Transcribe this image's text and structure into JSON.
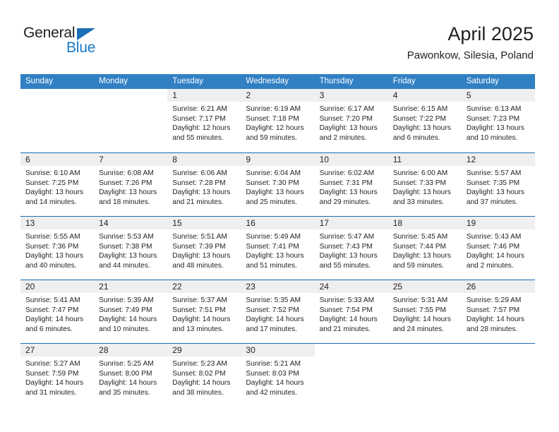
{
  "branding": {
    "logo_primary": "General",
    "logo_secondary": "Blue"
  },
  "header": {
    "title": "April 2025",
    "subtitle": "Pawonkow, Silesia, Poland"
  },
  "colors": {
    "header_blue": "#3180c4",
    "row_divider_blue": "#1f6cb0",
    "daynum_band": "#efefef",
    "logo_blue": "#1878c4",
    "text": "#231f20"
  },
  "weekdays": [
    "Sunday",
    "Monday",
    "Tuesday",
    "Wednesday",
    "Thursday",
    "Friday",
    "Saturday"
  ],
  "weeks": [
    [
      {
        "day": "",
        "sunrise": "",
        "sunset": "",
        "daylight_1": "",
        "daylight_2": ""
      },
      {
        "day": "",
        "sunrise": "",
        "sunset": "",
        "daylight_1": "",
        "daylight_2": ""
      },
      {
        "day": "1",
        "sunrise": "Sunrise: 6:21 AM",
        "sunset": "Sunset: 7:17 PM",
        "daylight_1": "Daylight: 12 hours",
        "daylight_2": "and 55 minutes."
      },
      {
        "day": "2",
        "sunrise": "Sunrise: 6:19 AM",
        "sunset": "Sunset: 7:18 PM",
        "daylight_1": "Daylight: 12 hours",
        "daylight_2": "and 59 minutes."
      },
      {
        "day": "3",
        "sunrise": "Sunrise: 6:17 AM",
        "sunset": "Sunset: 7:20 PM",
        "daylight_1": "Daylight: 13 hours",
        "daylight_2": "and 2 minutes."
      },
      {
        "day": "4",
        "sunrise": "Sunrise: 6:15 AM",
        "sunset": "Sunset: 7:22 PM",
        "daylight_1": "Daylight: 13 hours",
        "daylight_2": "and 6 minutes."
      },
      {
        "day": "5",
        "sunrise": "Sunrise: 6:13 AM",
        "sunset": "Sunset: 7:23 PM",
        "daylight_1": "Daylight: 13 hours",
        "daylight_2": "and 10 minutes."
      }
    ],
    [
      {
        "day": "6",
        "sunrise": "Sunrise: 6:10 AM",
        "sunset": "Sunset: 7:25 PM",
        "daylight_1": "Daylight: 13 hours",
        "daylight_2": "and 14 minutes."
      },
      {
        "day": "7",
        "sunrise": "Sunrise: 6:08 AM",
        "sunset": "Sunset: 7:26 PM",
        "daylight_1": "Daylight: 13 hours",
        "daylight_2": "and 18 minutes."
      },
      {
        "day": "8",
        "sunrise": "Sunrise: 6:06 AM",
        "sunset": "Sunset: 7:28 PM",
        "daylight_1": "Daylight: 13 hours",
        "daylight_2": "and 21 minutes."
      },
      {
        "day": "9",
        "sunrise": "Sunrise: 6:04 AM",
        "sunset": "Sunset: 7:30 PM",
        "daylight_1": "Daylight: 13 hours",
        "daylight_2": "and 25 minutes."
      },
      {
        "day": "10",
        "sunrise": "Sunrise: 6:02 AM",
        "sunset": "Sunset: 7:31 PM",
        "daylight_1": "Daylight: 13 hours",
        "daylight_2": "and 29 minutes."
      },
      {
        "day": "11",
        "sunrise": "Sunrise: 6:00 AM",
        "sunset": "Sunset: 7:33 PM",
        "daylight_1": "Daylight: 13 hours",
        "daylight_2": "and 33 minutes."
      },
      {
        "day": "12",
        "sunrise": "Sunrise: 5:57 AM",
        "sunset": "Sunset: 7:35 PM",
        "daylight_1": "Daylight: 13 hours",
        "daylight_2": "and 37 minutes."
      }
    ],
    [
      {
        "day": "13",
        "sunrise": "Sunrise: 5:55 AM",
        "sunset": "Sunset: 7:36 PM",
        "daylight_1": "Daylight: 13 hours",
        "daylight_2": "and 40 minutes."
      },
      {
        "day": "14",
        "sunrise": "Sunrise: 5:53 AM",
        "sunset": "Sunset: 7:38 PM",
        "daylight_1": "Daylight: 13 hours",
        "daylight_2": "and 44 minutes."
      },
      {
        "day": "15",
        "sunrise": "Sunrise: 5:51 AM",
        "sunset": "Sunset: 7:39 PM",
        "daylight_1": "Daylight: 13 hours",
        "daylight_2": "and 48 minutes."
      },
      {
        "day": "16",
        "sunrise": "Sunrise: 5:49 AM",
        "sunset": "Sunset: 7:41 PM",
        "daylight_1": "Daylight: 13 hours",
        "daylight_2": "and 51 minutes."
      },
      {
        "day": "17",
        "sunrise": "Sunrise: 5:47 AM",
        "sunset": "Sunset: 7:43 PM",
        "daylight_1": "Daylight: 13 hours",
        "daylight_2": "and 55 minutes."
      },
      {
        "day": "18",
        "sunrise": "Sunrise: 5:45 AM",
        "sunset": "Sunset: 7:44 PM",
        "daylight_1": "Daylight: 13 hours",
        "daylight_2": "and 59 minutes."
      },
      {
        "day": "19",
        "sunrise": "Sunrise: 5:43 AM",
        "sunset": "Sunset: 7:46 PM",
        "daylight_1": "Daylight: 14 hours",
        "daylight_2": "and 2 minutes."
      }
    ],
    [
      {
        "day": "20",
        "sunrise": "Sunrise: 5:41 AM",
        "sunset": "Sunset: 7:47 PM",
        "daylight_1": "Daylight: 14 hours",
        "daylight_2": "and 6 minutes."
      },
      {
        "day": "21",
        "sunrise": "Sunrise: 5:39 AM",
        "sunset": "Sunset: 7:49 PM",
        "daylight_1": "Daylight: 14 hours",
        "daylight_2": "and 10 minutes."
      },
      {
        "day": "22",
        "sunrise": "Sunrise: 5:37 AM",
        "sunset": "Sunset: 7:51 PM",
        "daylight_1": "Daylight: 14 hours",
        "daylight_2": "and 13 minutes."
      },
      {
        "day": "23",
        "sunrise": "Sunrise: 5:35 AM",
        "sunset": "Sunset: 7:52 PM",
        "daylight_1": "Daylight: 14 hours",
        "daylight_2": "and 17 minutes."
      },
      {
        "day": "24",
        "sunrise": "Sunrise: 5:33 AM",
        "sunset": "Sunset: 7:54 PM",
        "daylight_1": "Daylight: 14 hours",
        "daylight_2": "and 21 minutes."
      },
      {
        "day": "25",
        "sunrise": "Sunrise: 5:31 AM",
        "sunset": "Sunset: 7:55 PM",
        "daylight_1": "Daylight: 14 hours",
        "daylight_2": "and 24 minutes."
      },
      {
        "day": "26",
        "sunrise": "Sunrise: 5:29 AM",
        "sunset": "Sunset: 7:57 PM",
        "daylight_1": "Daylight: 14 hours",
        "daylight_2": "and 28 minutes."
      }
    ],
    [
      {
        "day": "27",
        "sunrise": "Sunrise: 5:27 AM",
        "sunset": "Sunset: 7:59 PM",
        "daylight_1": "Daylight: 14 hours",
        "daylight_2": "and 31 minutes."
      },
      {
        "day": "28",
        "sunrise": "Sunrise: 5:25 AM",
        "sunset": "Sunset: 8:00 PM",
        "daylight_1": "Daylight: 14 hours",
        "daylight_2": "and 35 minutes."
      },
      {
        "day": "29",
        "sunrise": "Sunrise: 5:23 AM",
        "sunset": "Sunset: 8:02 PM",
        "daylight_1": "Daylight: 14 hours",
        "daylight_2": "and 38 minutes."
      },
      {
        "day": "30",
        "sunrise": "Sunrise: 5:21 AM",
        "sunset": "Sunset: 8:03 PM",
        "daylight_1": "Daylight: 14 hours",
        "daylight_2": "and 42 minutes."
      },
      {
        "day": "",
        "sunrise": "",
        "sunset": "",
        "daylight_1": "",
        "daylight_2": ""
      },
      {
        "day": "",
        "sunrise": "",
        "sunset": "",
        "daylight_1": "",
        "daylight_2": ""
      },
      {
        "day": "",
        "sunrise": "",
        "sunset": "",
        "daylight_1": "",
        "daylight_2": ""
      }
    ]
  ]
}
